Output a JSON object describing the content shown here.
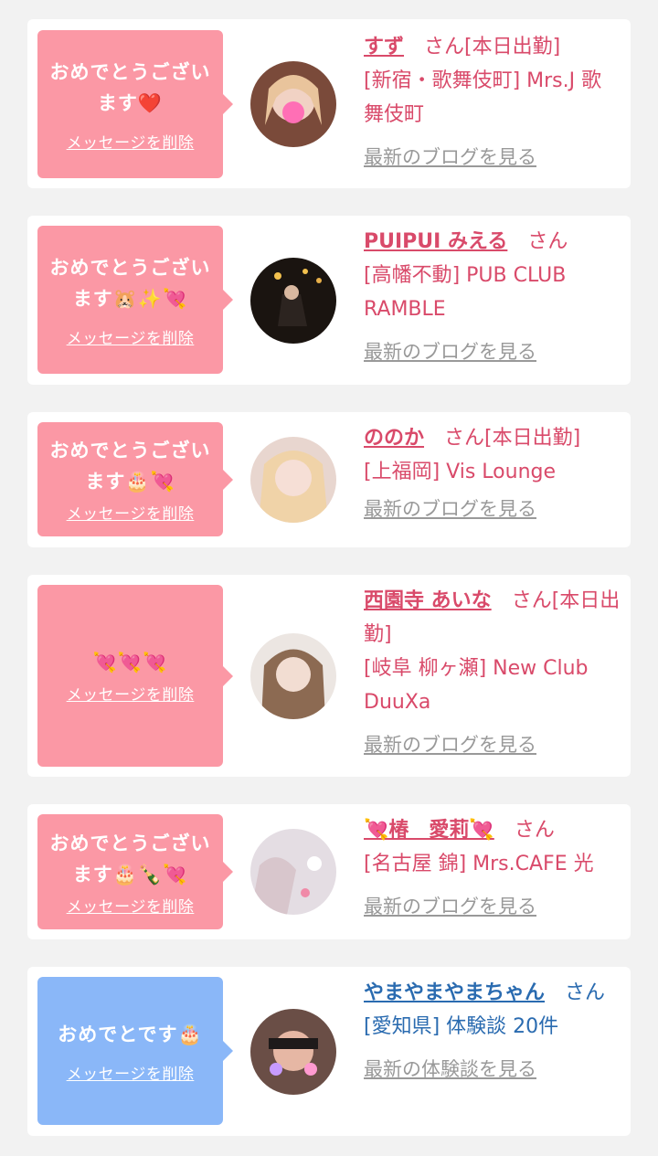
{
  "cards": [
    {
      "message": "おめでとうございます",
      "emoji": "❤️",
      "delete_label": "メッセージを削除",
      "name": "すず",
      "san": "さん[本日出勤]",
      "shop": "[新宿・歌舞伎町] Mrs.J 歌舞伎町",
      "link": "最新のブログを見る",
      "bubble_color": "#fb98a5"
    },
    {
      "message": "おめでとうございます",
      "emoji": "🐹✨💘",
      "delete_label": "メッセージを削除",
      "name": "PUIPUI みえる",
      "san": "さん",
      "shop": "[高幡不動] PUB CLUB RAMBLE",
      "link": "最新のブログを見る",
      "bubble_color": "#fb98a5"
    },
    {
      "message": "おめでとうございます",
      "emoji": "🎂💘",
      "delete_label": "メッセージを削除",
      "name": "ののか",
      "san": "さん[本日出勤]",
      "shop": "[上福岡] Vis Lounge",
      "link": "最新のブログを見る",
      "bubble_color": "#fb98a5"
    },
    {
      "message": "",
      "emoji": "💘💘💘",
      "delete_label": "メッセージを削除",
      "name": "西園寺 あいな",
      "san": "さん[本日出勤]",
      "shop": "[岐阜 柳ヶ瀬] New Club DuuXa",
      "link": "最新のブログを見る",
      "bubble_color": "#fb98a5"
    },
    {
      "message": "おめでとうございます",
      "emoji": "🎂🍾💘",
      "delete_label": "メッセージを削除",
      "name": "💘椿　愛莉💘",
      "san": "さん",
      "shop": "[名古屋 錦] Mrs.CAFE 光",
      "link": "最新のブログを見る",
      "bubble_color": "#fb98a5"
    },
    {
      "message": "おめでとです",
      "emoji": "🎂",
      "delete_label": "メッセージを削除",
      "name": "やまやまやまちゃん",
      "san": "さん",
      "shop": "[愛知県] 体験談 20件",
      "link": "最新の体験談を見る",
      "bubble_color": "#8ab7f8"
    }
  ]
}
